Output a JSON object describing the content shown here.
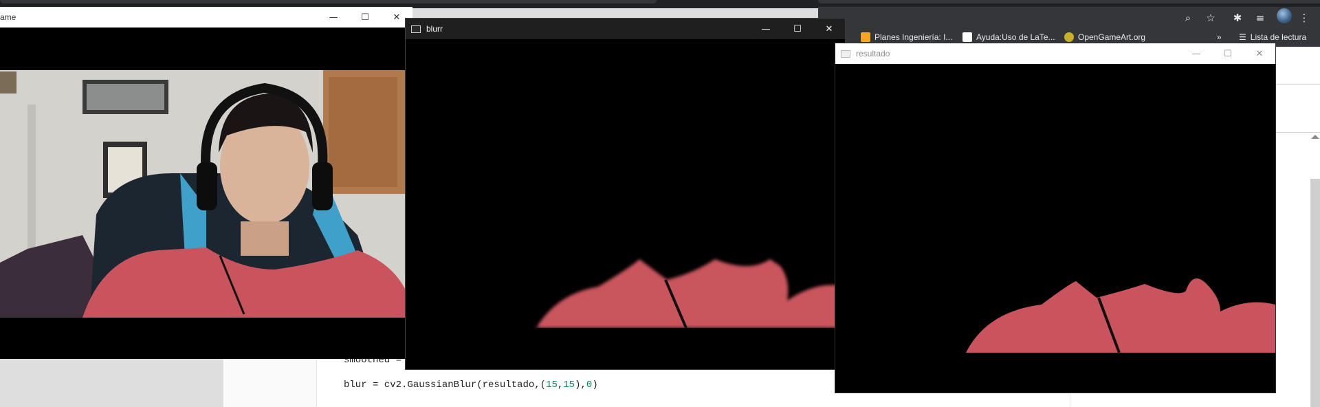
{
  "browser": {
    "bookmarks": [
      {
        "label": "Planes Ingeniería: I...",
        "color": "#f5a623"
      },
      {
        "label": "Ayuda:Uso de LaTe...",
        "color": "#ffffff"
      },
      {
        "label": "OpenGameArt.org",
        "color": "#c9b02b"
      }
    ],
    "more_label": "»",
    "reading_list": "Lista de lectura",
    "toolbar_icons": [
      "zoom-icon",
      "star-icon",
      "extensions-icon",
      "media-icon",
      "profile-avatar",
      "menu-icon"
    ]
  },
  "code": {
    "line1": "smoothed = ",
    "line2_prefix": "blur = cv2.GaussianBlur(resultado,(",
    "line2_n1": "15",
    "line2_sep": ",",
    "line2_n2": "15",
    "line2_mid": "),",
    "line2_n3": "0",
    "line2_end": ")"
  },
  "windows": {
    "frame": {
      "title": "ame"
    },
    "blurr": {
      "title": "blurr"
    },
    "resultado": {
      "title": "resultado"
    }
  },
  "controls": {
    "minimize": "—",
    "maximize": "☐",
    "close": "✕"
  },
  "colors": {
    "shirt": "#c9545d",
    "shirt_dark": "#a8424b",
    "chair_blue": "#3fa0c9",
    "wall": "#cfcdc8",
    "door": "#b07a4c"
  }
}
